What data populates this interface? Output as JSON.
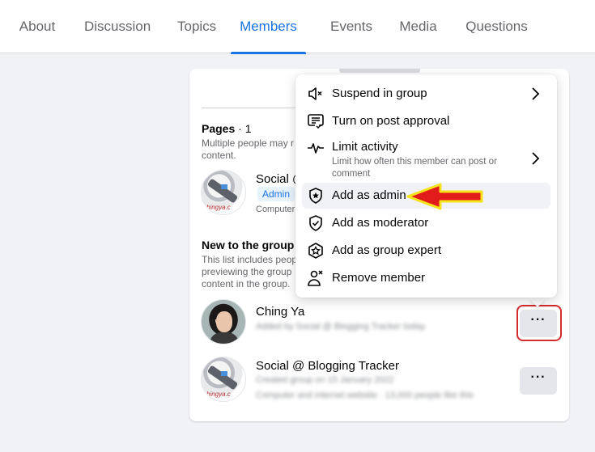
{
  "tabs": [
    {
      "label": "About",
      "active": false
    },
    {
      "label": "Discussion",
      "active": false
    },
    {
      "label": "Topics",
      "active": false
    },
    {
      "label": "Members",
      "active": true
    },
    {
      "label": "Events",
      "active": false
    },
    {
      "label": "Media",
      "active": false
    },
    {
      "label": "Questions",
      "active": false
    }
  ],
  "colors": {
    "accent": "#1b74e4",
    "annotation_red": "#e21b1b",
    "annotation_yellow": "#f5e31b"
  },
  "pages_section": {
    "title": "Pages",
    "count": " · 1",
    "description": "Multiple people may manage this Page and post content.",
    "description_visible": "Multiple people may r content.",
    "member": {
      "name": "Social @ Blogging Tracker",
      "name_visible": "Social @",
      "badge": "Admin",
      "subtext": "Computer"
    }
  },
  "new_section": {
    "title": "New to the group",
    "description": "This list includes peop previewing the group content in the group."
  },
  "members": [
    {
      "name": "Ching Ya",
      "subtext": "Added by Social @ Blogging Tracker today",
      "more_label": "···",
      "avatar": "person-photo"
    },
    {
      "name": "Social @ Blogging Tracker",
      "subtext": "Created group on 15 January 2022",
      "subtext2": "Computer and internet website · 13,000 people like this",
      "more_label": "···",
      "avatar": "page-logo"
    }
  ],
  "menu": {
    "items": [
      {
        "label": "Suspend in group",
        "icon": "speaker-mute-icon",
        "has_submenu": true
      },
      {
        "label": "Turn on post approval",
        "icon": "post-approval-icon",
        "has_submenu": false
      },
      {
        "label": "Limit activity",
        "sub": "Limit how often this member can post or comment",
        "icon": "activity-pulse-icon",
        "has_submenu": true
      },
      {
        "label": "Add as admin",
        "icon": "shield-star-icon",
        "has_submenu": false,
        "highlighted": true
      },
      {
        "label": "Add as moderator",
        "icon": "shield-check-icon",
        "has_submenu": false
      },
      {
        "label": "Add as group expert",
        "icon": "expert-badge-icon",
        "has_submenu": false
      },
      {
        "label": "Remove member",
        "icon": "remove-person-icon",
        "has_submenu": false
      }
    ]
  }
}
